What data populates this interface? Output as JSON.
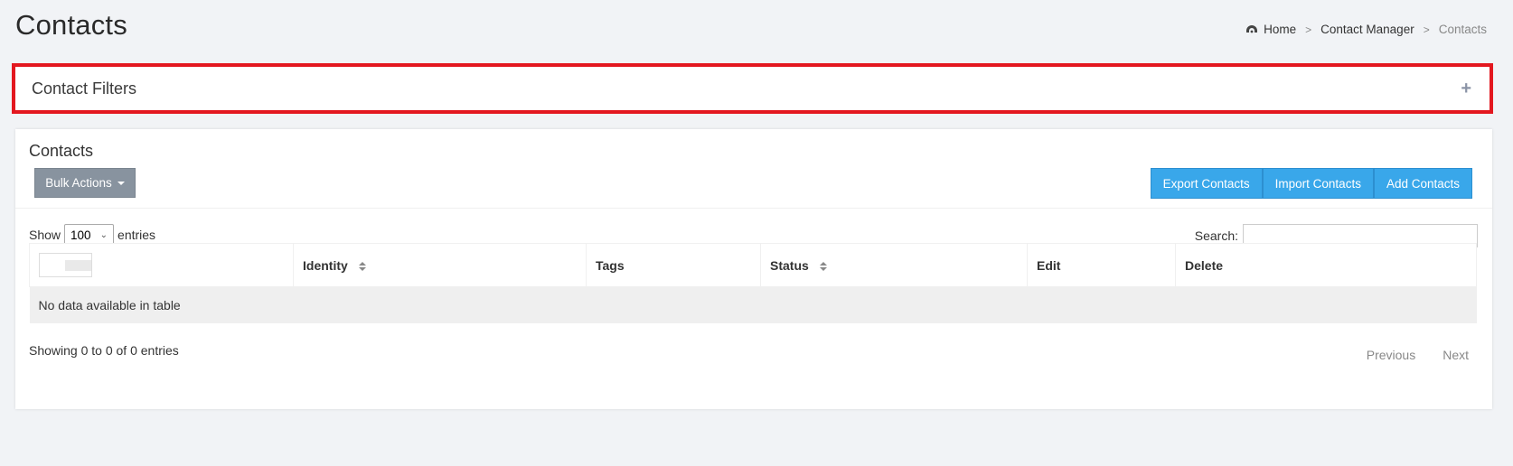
{
  "page": {
    "title": "Contacts"
  },
  "breadcrumb": {
    "home": "Home",
    "manager": "Contact Manager",
    "current": "Contacts",
    "separator": ">"
  },
  "filters": {
    "title": "Contact Filters",
    "toggle": "+"
  },
  "contacts_card": {
    "title": "Contacts",
    "bulk_actions": "Bulk Actions",
    "actions": {
      "export": "Export Contacts",
      "import": "Import Contacts",
      "add": "Add Contacts"
    },
    "show_label": "Show",
    "entries_value": "100",
    "entries_label": "entries",
    "search_label": "Search:",
    "columns": [
      "Identity",
      "Tags",
      "Status",
      "Edit",
      "Delete"
    ],
    "empty_message": "No data available in table",
    "info": "Showing 0 to 0 of 0 entries",
    "pagination": {
      "previous": "Previous",
      "next": "Next"
    }
  },
  "colors": {
    "accent_blue": "#39a7ea",
    "bulk_gray": "#88939f",
    "highlight_red": "#e3171f"
  },
  "icons": {
    "breadcrumb_home": "dashboard-icon",
    "filters_toggle": "plus-icon",
    "sort": "sort-icon"
  }
}
